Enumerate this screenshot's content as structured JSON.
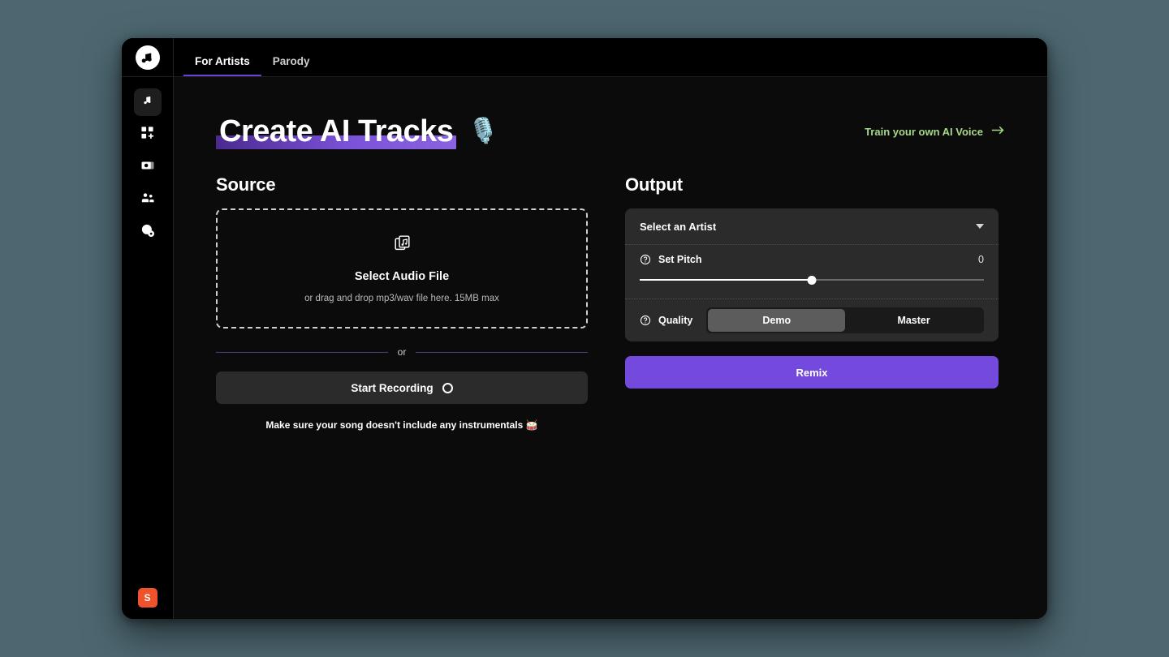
{
  "window": {
    "background_color": "#4d6770",
    "surface_color": "#0b0b0b"
  },
  "topbar": {
    "logo_icon": "music-note-circle-logo",
    "tabs": [
      {
        "label": "For Artists",
        "active": true
      },
      {
        "label": "Parody",
        "active": false
      }
    ],
    "active_tab_color": "#6d3fd4"
  },
  "sidebar": {
    "items": [
      {
        "name": "music-note-icon",
        "label": "Tracks",
        "active": true
      },
      {
        "name": "grid-plus-icon",
        "label": "Create",
        "active": false
      },
      {
        "name": "media-cards-icon",
        "label": "Library",
        "active": false
      },
      {
        "name": "people-icon",
        "label": "Community",
        "active": false
      },
      {
        "name": "globe-gear-icon",
        "label": "Settings",
        "active": false
      }
    ],
    "avatar": {
      "initial": "S",
      "color": "#f0522c"
    }
  },
  "header": {
    "title": "Create AI Tracks",
    "title_emoji": "🎙️",
    "highlight_gradient": "#4b2a8f → #8a63e0",
    "train_link": {
      "label": "Train your own AI Voice",
      "icon": "arrow-right-icon",
      "color": "#a8d98a"
    }
  },
  "source": {
    "section_title": "Source",
    "dropzone": {
      "icon": "audio-files-stack-icon",
      "title": "Select Audio File",
      "subtitle": "or drag and drop mp3/wav file here. 15MB max"
    },
    "divider_text": "or",
    "record_button": {
      "label": "Start Recording",
      "icon": "record-circle-icon"
    },
    "note": "Make sure your song doesn't include any instrumentals 🥁"
  },
  "output": {
    "section_title": "Output",
    "artist_select": {
      "value": "Select an Artist",
      "icon": "chevron-down-icon"
    },
    "pitch": {
      "help_icon": "question-circle-icon",
      "label": "Set Pitch",
      "value": "0",
      "slider_percent": 50
    },
    "quality": {
      "help_icon": "question-circle-icon",
      "label": "Quality",
      "options": [
        {
          "label": "Demo",
          "selected": true
        },
        {
          "label": "Master",
          "selected": false
        }
      ]
    },
    "remix_button": {
      "label": "Remix",
      "color": "#7449de"
    }
  }
}
